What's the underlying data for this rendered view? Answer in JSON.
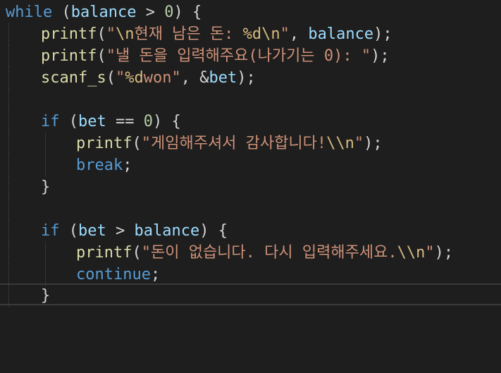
{
  "editor": {
    "lines": [
      [
        {
          "t": "while",
          "c": "kw"
        },
        {
          "t": " (",
          "c": "op"
        },
        {
          "t": "balance",
          "c": "var"
        },
        {
          "t": " > ",
          "c": "op"
        },
        {
          "t": "0",
          "c": "num"
        },
        {
          "t": ") {",
          "c": "op"
        }
      ],
      [
        {
          "t": "printf",
          "c": "fn"
        },
        {
          "t": "(",
          "c": "op"
        },
        {
          "t": "\"",
          "c": "str"
        },
        {
          "t": "\\n",
          "c": "esc"
        },
        {
          "t": "현재 남은 돈: ",
          "c": "str"
        },
        {
          "t": "%d",
          "c": "esc"
        },
        {
          "t": "\\n",
          "c": "esc"
        },
        {
          "t": "\"",
          "c": "str"
        },
        {
          "t": ", ",
          "c": "op"
        },
        {
          "t": "balance",
          "c": "var"
        },
        {
          "t": ");",
          "c": "op"
        }
      ],
      [
        {
          "t": "printf",
          "c": "fn"
        },
        {
          "t": "(",
          "c": "op"
        },
        {
          "t": "\"낼 돈을 입력해주요(나가기는 0): \"",
          "c": "str"
        },
        {
          "t": ");",
          "c": "op"
        }
      ],
      [
        {
          "t": "scanf_s",
          "c": "fn"
        },
        {
          "t": "(",
          "c": "op"
        },
        {
          "t": "\"",
          "c": "str"
        },
        {
          "t": "%d",
          "c": "esc"
        },
        {
          "t": "won\"",
          "c": "str"
        },
        {
          "t": ", &",
          "c": "op"
        },
        {
          "t": "bet",
          "c": "var"
        },
        {
          "t": ");",
          "c": "op"
        }
      ],
      [],
      [
        {
          "t": "if",
          "c": "kw"
        },
        {
          "t": " (",
          "c": "op"
        },
        {
          "t": "bet",
          "c": "var"
        },
        {
          "t": " == ",
          "c": "op"
        },
        {
          "t": "0",
          "c": "num"
        },
        {
          "t": ") {",
          "c": "op"
        }
      ],
      [
        {
          "t": "printf",
          "c": "fn"
        },
        {
          "t": "(",
          "c": "op"
        },
        {
          "t": "\"게임해주셔서 감사합니다!",
          "c": "str"
        },
        {
          "t": "\\\\n",
          "c": "esc"
        },
        {
          "t": "\"",
          "c": "str"
        },
        {
          "t": ");",
          "c": "op"
        }
      ],
      [
        {
          "t": "break",
          "c": "kw"
        },
        {
          "t": ";",
          "c": "op"
        }
      ],
      [
        {
          "t": "}",
          "c": "op"
        }
      ],
      [],
      [
        {
          "t": "if",
          "c": "kw"
        },
        {
          "t": " (",
          "c": "op"
        },
        {
          "t": "bet",
          "c": "var"
        },
        {
          "t": " > ",
          "c": "op"
        },
        {
          "t": "balance",
          "c": "var"
        },
        {
          "t": ") {",
          "c": "op"
        }
      ],
      [
        {
          "t": "printf",
          "c": "fn"
        },
        {
          "t": "(",
          "c": "op"
        },
        {
          "t": "\"돈이 없습니다. 다시 입력해주세요.",
          "c": "str"
        },
        {
          "t": "\\\\n",
          "c": "esc"
        },
        {
          "t": "\"",
          "c": "str"
        },
        {
          "t": ");",
          "c": "op"
        }
      ],
      [
        {
          "t": "continue",
          "c": "kw"
        },
        {
          "t": ";",
          "c": "op"
        }
      ],
      [
        {
          "t": "}",
          "c": "op"
        }
      ]
    ]
  },
  "colors": {
    "background": "#1e1e1e",
    "keyword": "#569cd6",
    "function": "#dcdcaa",
    "string": "#ce9178",
    "escape": "#d7ba7d",
    "variable": "#9cdcfe",
    "number": "#b5cea8",
    "punctuation": "#d4d4d4"
  }
}
